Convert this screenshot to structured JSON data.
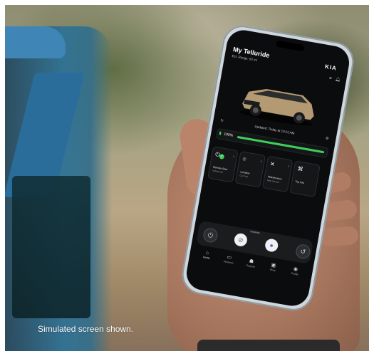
{
  "caption": "Simulated screen shown.",
  "app": {
    "vehicle_title": "My Telluride",
    "vehicle_sub": "Est. Range: 92 mi",
    "brand_logo": "KIA",
    "header_icons": [
      "menu-icon",
      "bell-icon"
    ],
    "status_text": "Updated: Today at 10:22 AM",
    "charge_percent_label": "100%",
    "charge_level": 1.0,
    "accent_color": "#3dcf5a",
    "cards": [
      {
        "label": "Remote Start",
        "sublabel": "Vehicle Off",
        "icon": "power-icon"
      },
      {
        "label": "Location",
        "sublabel": "Car Find",
        "icon": "pin-icon"
      },
      {
        "label": "Maintenance",
        "sublabel": "Next Service",
        "icon": "wrench-icon"
      },
      {
        "label": "Trip Info",
        "sublabel": "",
        "icon": "binoculars-icon"
      }
    ],
    "dock_buttons": [
      "power-icon",
      "unlock-icon",
      "lock-icon",
      "horn-icon"
    ],
    "nav": [
      {
        "label": "Home",
        "icon": "home-icon"
      },
      {
        "label": "Features",
        "icon": "car-icon"
      },
      {
        "label": "Support",
        "icon": "support-icon"
      },
      {
        "label": "Shop",
        "icon": "shop-icon"
      },
      {
        "label": "Profile",
        "icon": "profile-icon"
      }
    ]
  }
}
